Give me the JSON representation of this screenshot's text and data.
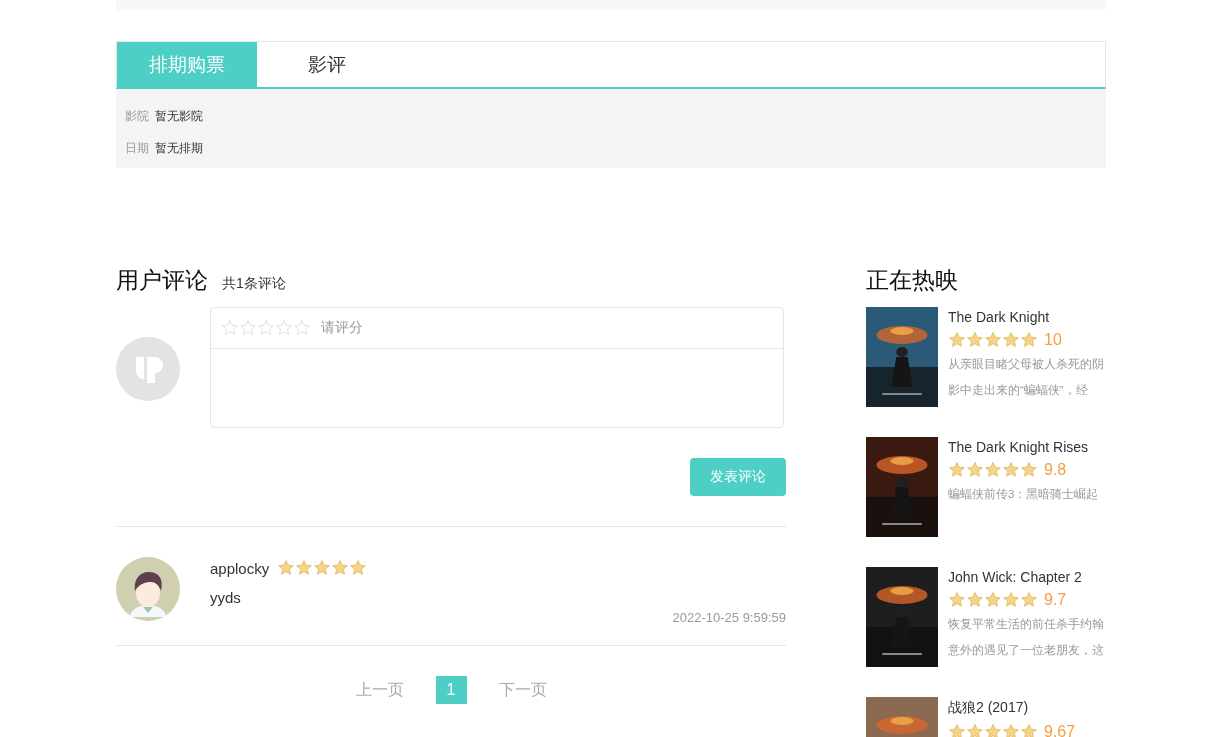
{
  "tabs": [
    {
      "label": "排期购票",
      "selected": true
    },
    {
      "label": "影评",
      "selected": false
    }
  ],
  "schedule": [
    {
      "label": "影院",
      "value": "暂无影院"
    },
    {
      "label": "日期",
      "value": "暂无排期"
    }
  ],
  "comments_section": {
    "title": "用户评论",
    "count": "共1条评论",
    "rating_input": {
      "stars": 0,
      "hint": "请评分"
    },
    "submit": "发表评论"
  },
  "comments": [
    {
      "user": "applocky",
      "stars": 5,
      "text": "yyds",
      "time": "2022-10-25 9:59:59"
    }
  ],
  "pagination": {
    "prev": {
      "label": "上一页",
      "disabled": true
    },
    "pages": [
      {
        "label": "1",
        "selected": true
      }
    ],
    "next": {
      "label": "下一页",
      "disabled": true
    }
  },
  "now_showing": {
    "title": "正在热映",
    "movies": [
      {
        "title": "The Dark Knight",
        "stars": 5,
        "score": "10",
        "summary": "从亲眼目睹父母被人杀死的阴影中走出来的“蝙蝠侠”，经"
      },
      {
        "title": "The Dark Knight Rises",
        "stars": 5,
        "score": "9.8",
        "summary": "蝙蝠侠前传3：黑暗骑士崛起"
      },
      {
        "title": "John Wick: Chapter 2",
        "stars": 5,
        "score": "9.7",
        "summary": "恢复平常生活的前任杀手约翰意外的遇见了一位老朋友，这"
      },
      {
        "title": "战狼2 (2017)",
        "stars": 5,
        "score": "9.67"
      }
    ]
  }
}
